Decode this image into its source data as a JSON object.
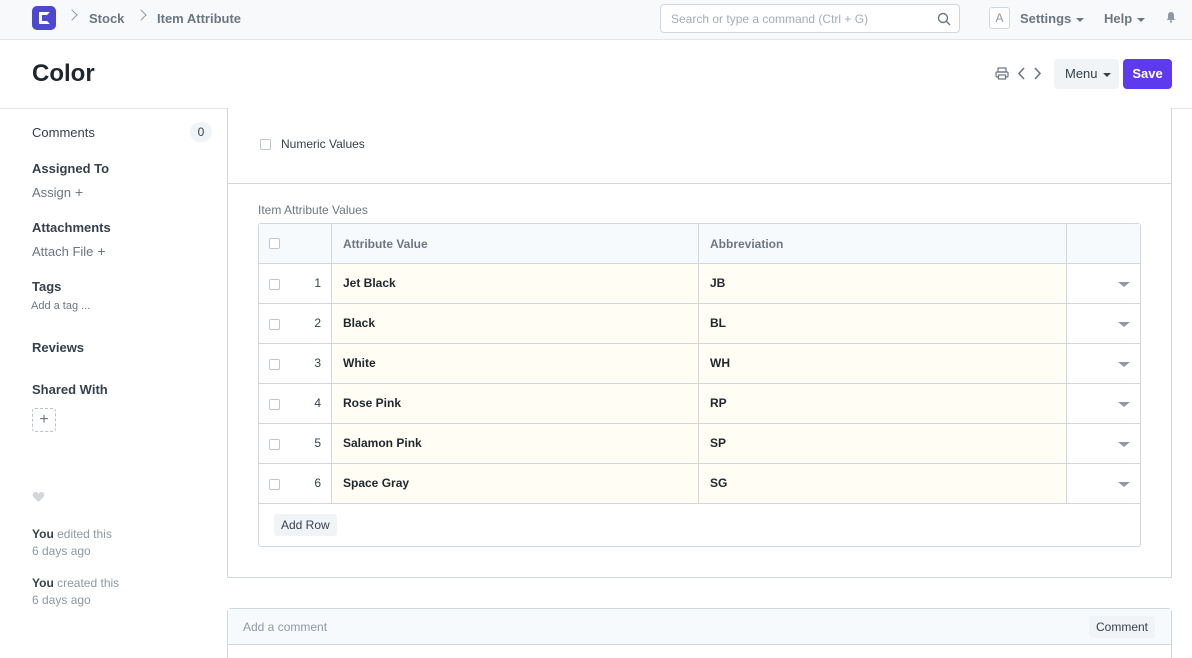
{
  "navbar": {
    "breadcrumbs": [
      "Stock",
      "Item Attribute"
    ],
    "search_placeholder": "Search or type a command (Ctrl + G)",
    "avatar_letter": "A",
    "settings_label": "Settings",
    "help_label": "Help"
  },
  "header": {
    "title": "Color",
    "menu_label": "Menu",
    "save_label": "Save"
  },
  "sidebar": {
    "comments_label": "Comments",
    "comments_count": "0",
    "assigned_label": "Assigned To",
    "assign_action": "Assign",
    "attachments_label": "Attachments",
    "attach_action": "Attach File",
    "tags_label": "Tags",
    "tags_placeholder": "Add a tag ...",
    "reviews_label": "Reviews",
    "shared_label": "Shared With",
    "activity": [
      {
        "user": "You",
        "action": "edited this",
        "time": "6 days ago"
      },
      {
        "user": "You",
        "action": "created this",
        "time": "6 days ago"
      }
    ]
  },
  "form": {
    "numeric_label": "Numeric Values",
    "numeric_checked": false,
    "grid_label": "Item Attribute Values",
    "columns": [
      "Attribute Value",
      "Abbreviation"
    ],
    "rows": [
      {
        "idx": "1",
        "value": "Jet Black",
        "abbr": "JB"
      },
      {
        "idx": "2",
        "value": "Black",
        "abbr": "BL"
      },
      {
        "idx": "3",
        "value": "White",
        "abbr": "WH"
      },
      {
        "idx": "4",
        "value": "Rose Pink",
        "abbr": "RP"
      },
      {
        "idx": "5",
        "value": "Salamon Pink",
        "abbr": "SP"
      },
      {
        "idx": "6",
        "value": "Space Gray",
        "abbr": "SG"
      }
    ],
    "add_row_label": "Add Row"
  },
  "comment": {
    "placeholder": "Add a comment",
    "button_label": "Comment"
  },
  "colors": {
    "accent": "#5e3aee",
    "logo": "#4c48cf"
  }
}
